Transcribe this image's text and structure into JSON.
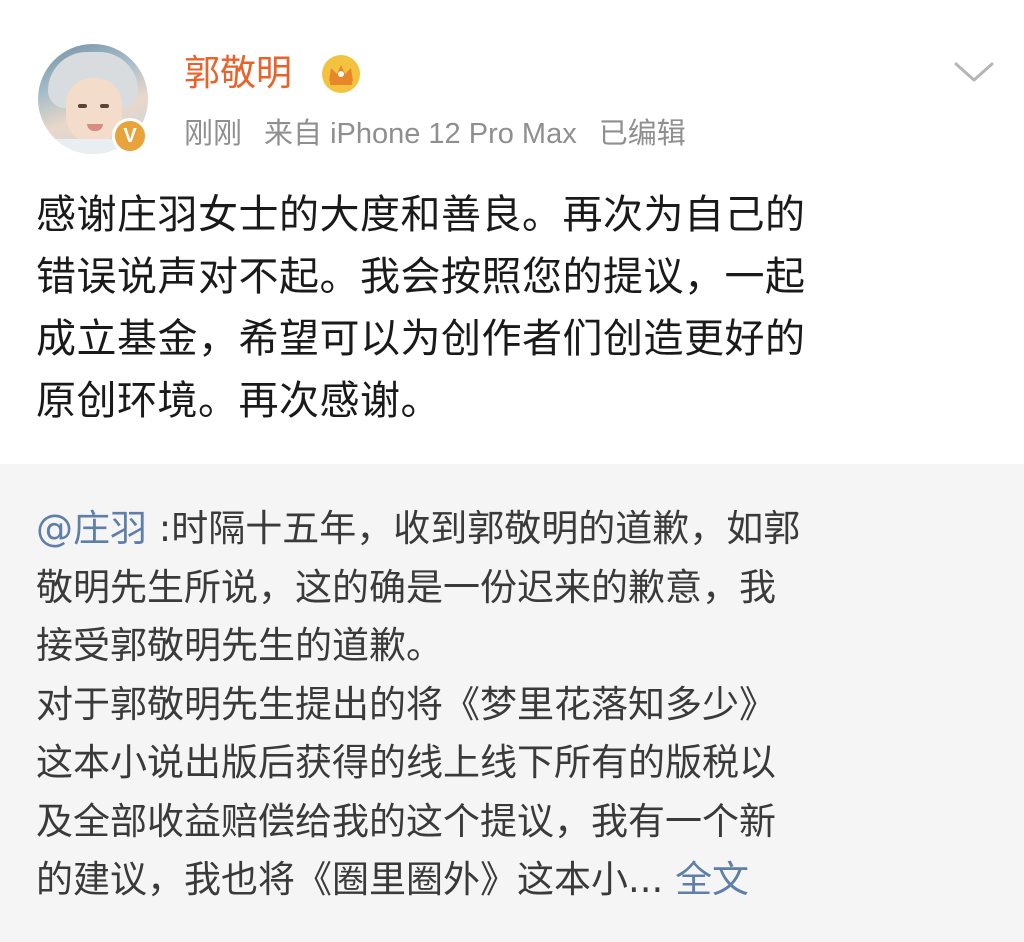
{
  "author": {
    "name": "郭敬明",
    "badge_letter": "V",
    "time": "刚刚",
    "source": "来自 iPhone 12 Pro Max",
    "edited": "已编辑"
  },
  "post": {
    "lines": [
      "感谢庄羽女士的大度和善良。再次为自己的",
      "错误说声对不起。我会按照您的提议，一起",
      "成立基金，希望可以为创作者们创造更好的",
      "原创环境。再次感谢。"
    ]
  },
  "repost": {
    "mention": "@庄羽",
    "first_line_rest": " :时隔十五年，收到郭敬明的道歉，如郭",
    "lines": [
      "敬明先生所说，这的确是一份迟来的歉意，我",
      "接受郭敬明先生的道歉。",
      "对于郭敬明先生提出的将《梦里花落知多少》",
      "这本小说出版后获得的线上线下所有的版税以",
      "及全部收益赔偿给我的这个提议，我有一个新"
    ],
    "last_line_text": "的建议，我也将《圈里圈外》这本小...",
    "more_label": "全文"
  },
  "icons": {
    "crown": "crown-icon",
    "chevron": "chevron-down-icon",
    "verified": "verified-badge"
  },
  "colors": {
    "username": "#e8622a",
    "link": "#5d7fa8",
    "meta": "#8f8f8f",
    "repost_bg": "#f5f5f5",
    "badge": "#e8a33a"
  }
}
